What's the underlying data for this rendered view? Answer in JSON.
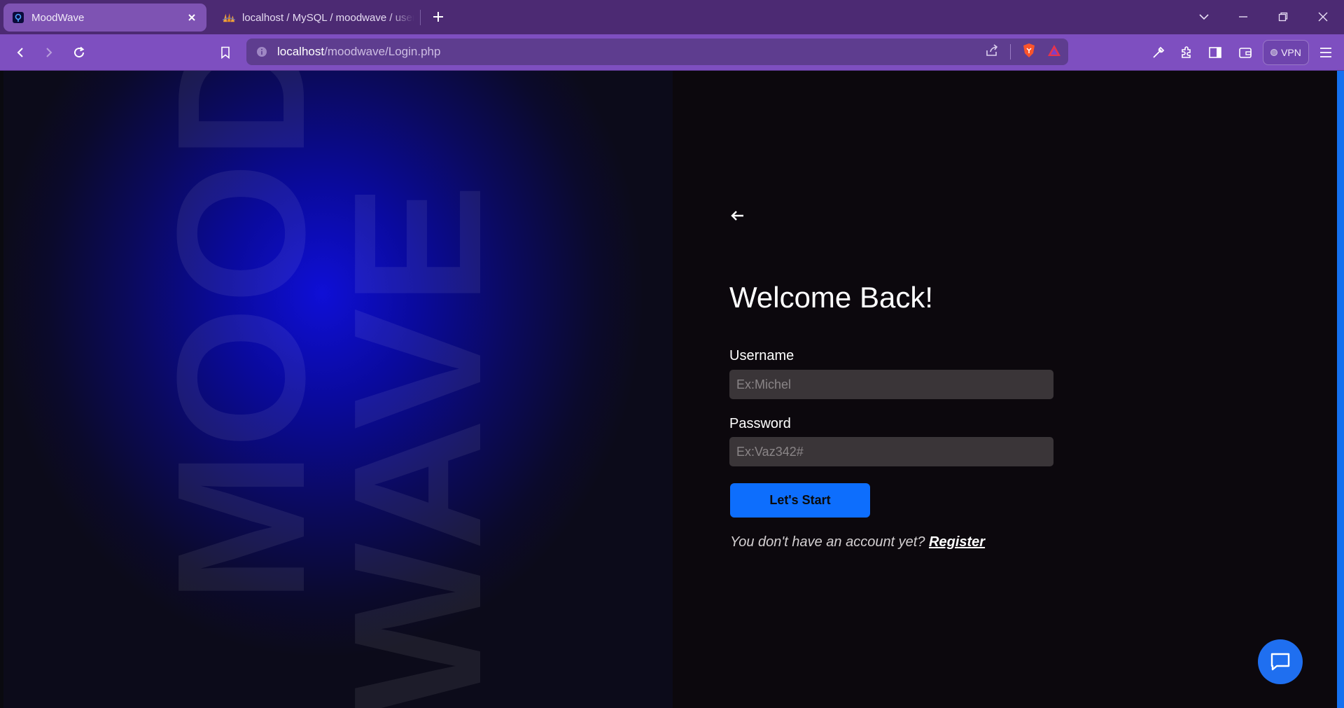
{
  "browser": {
    "tabs": [
      {
        "title": "MoodWave",
        "active": true
      },
      {
        "title": "localhost / MySQL / moodwave / users",
        "active": false
      }
    ],
    "address": {
      "host": "localhost",
      "path": "/moodwave/Login.php"
    },
    "vpn_label": "VPN"
  },
  "hero": {
    "word_1": "MOOD",
    "word_2": "WAVE"
  },
  "login": {
    "title": "Welcome Back!",
    "username_label": "Username",
    "username_placeholder": "Ex:Michel",
    "username_value": "",
    "password_label": "Password",
    "password_placeholder": "Ex:Vaz342#",
    "password_value": "",
    "submit_label": "Let's Start",
    "register_prompt": "You don't have an account yet?",
    "register_link": "Register"
  },
  "colors": {
    "tabbar": "#4c2a73",
    "toolbar": "#7e4fc0",
    "accent_blue": "#0d6efd",
    "page_bg": "#0c080d",
    "input_bg": "#3a3538"
  },
  "icons": {
    "back": "arrow-left-icon",
    "chat": "chat-bubble-icon"
  }
}
